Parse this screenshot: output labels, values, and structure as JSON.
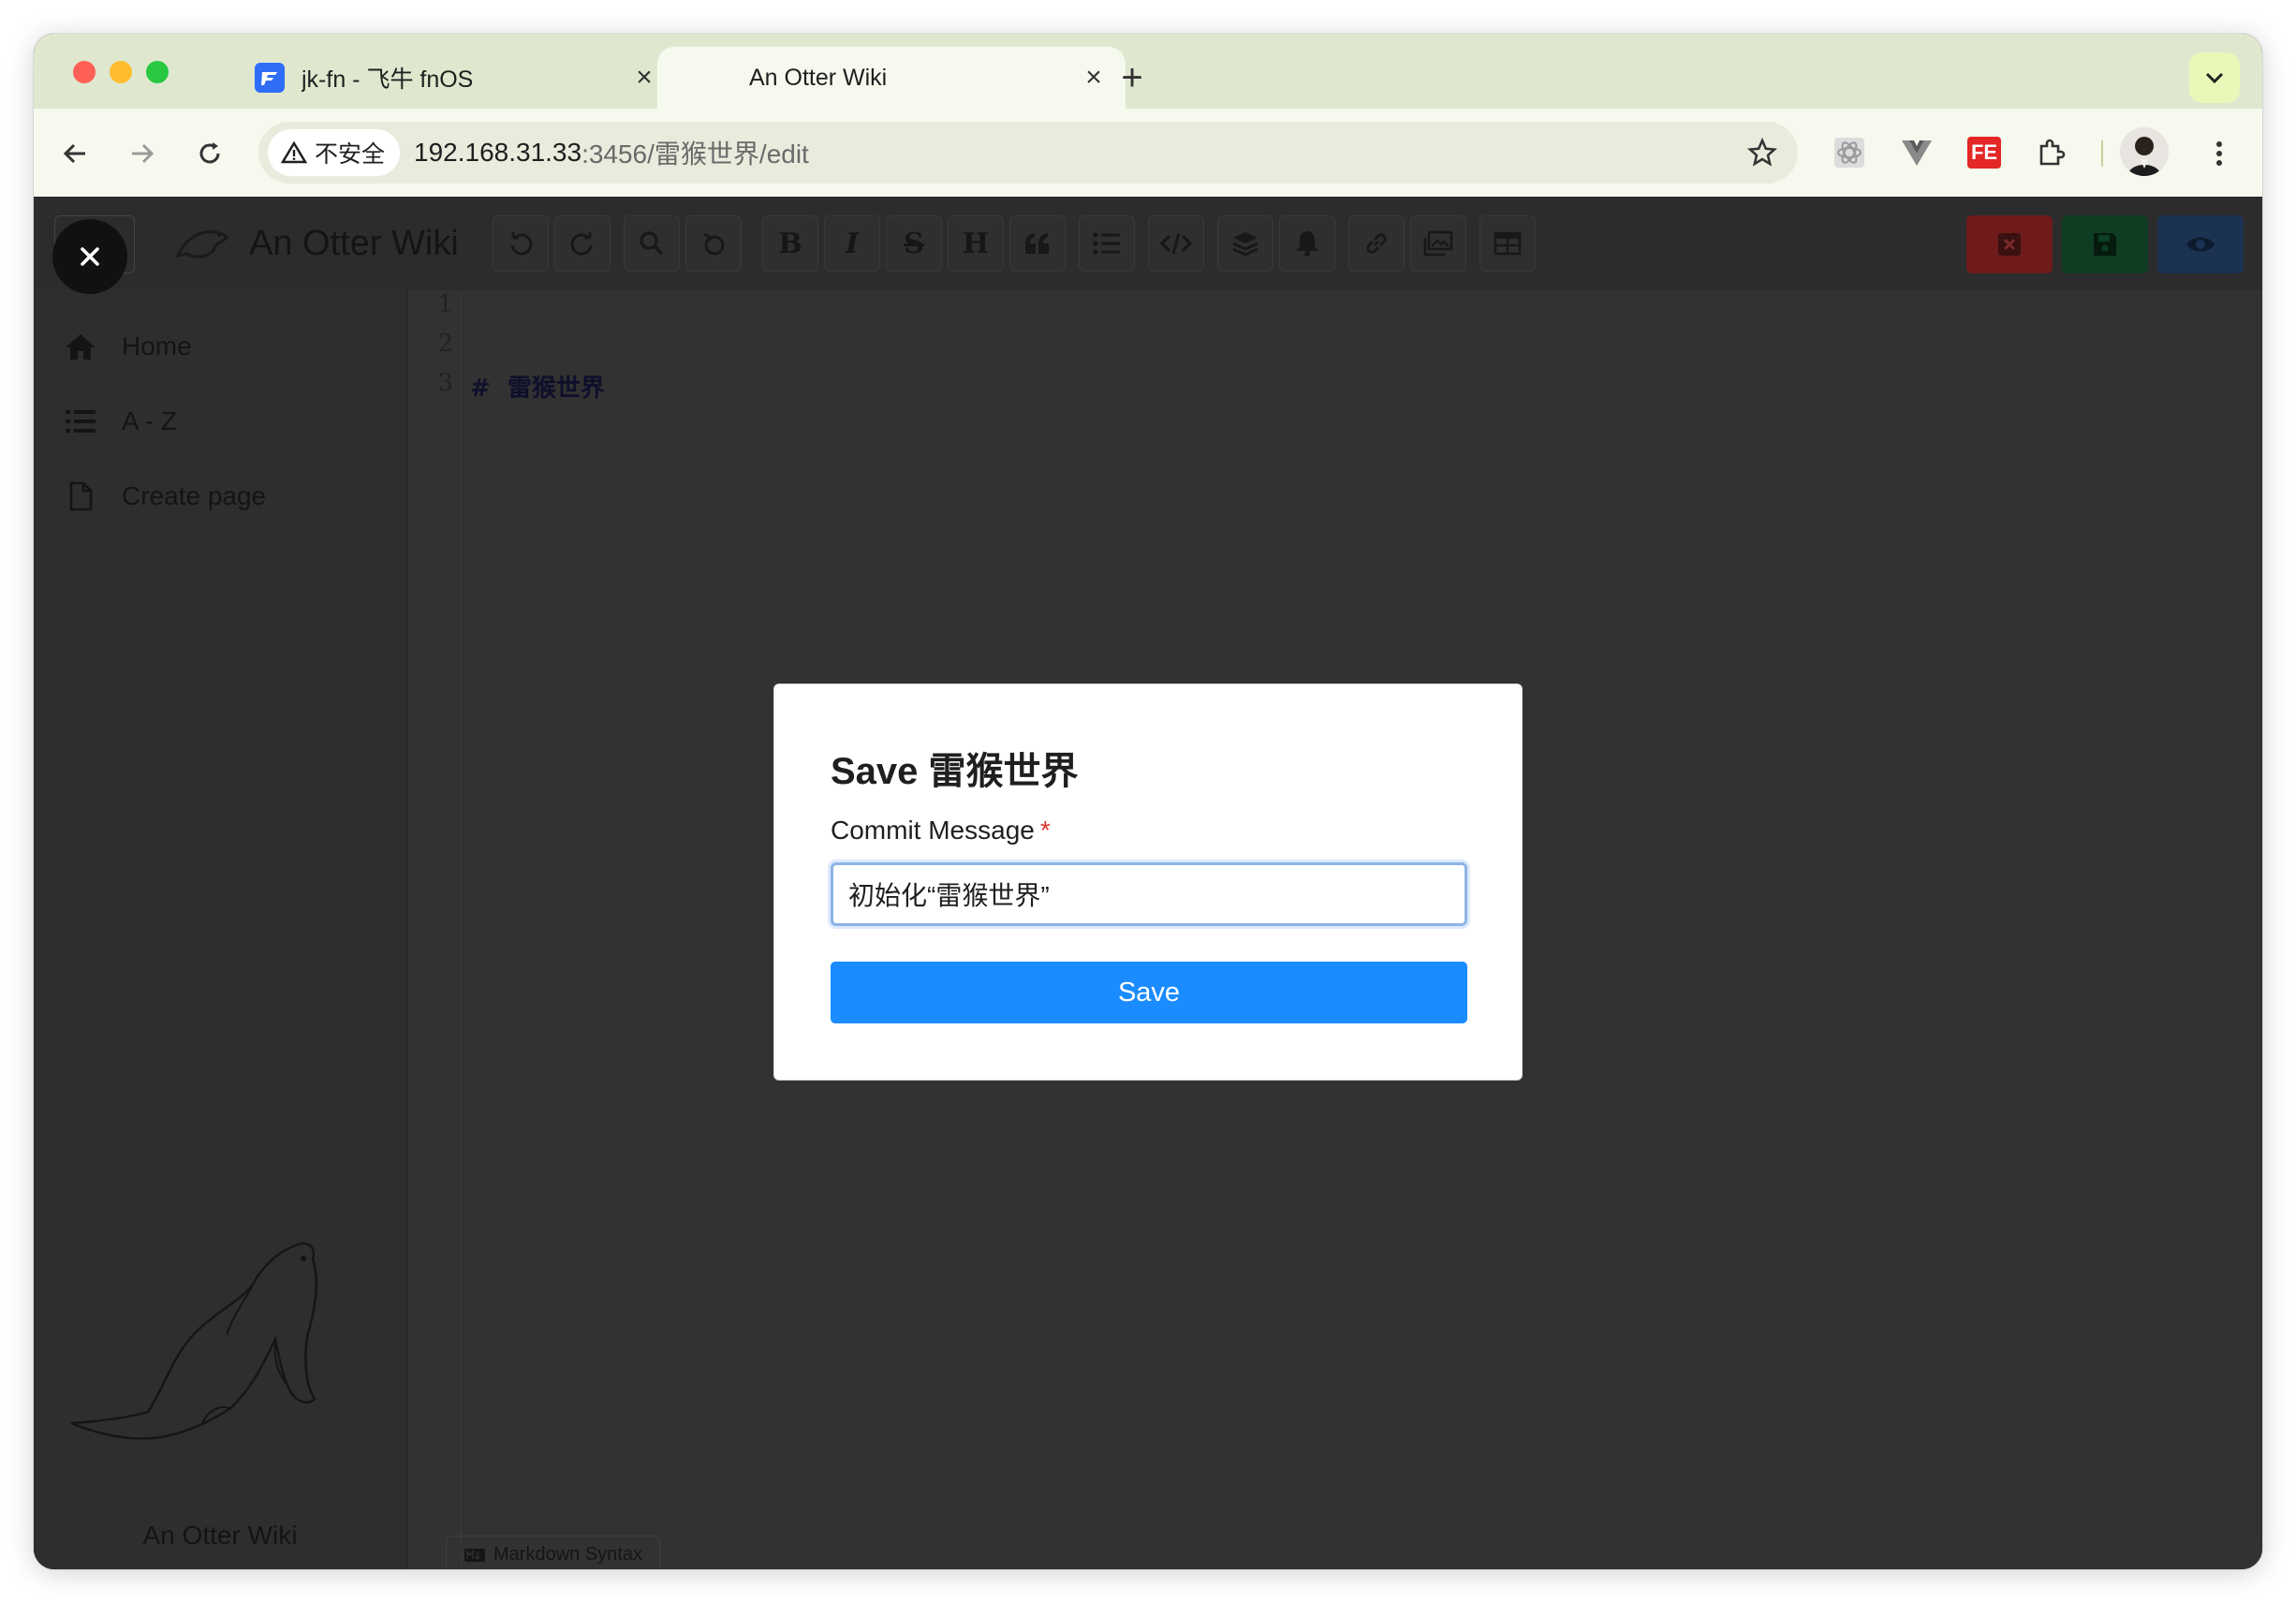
{
  "browser": {
    "tabs": [
      {
        "title": "jk-fn - 飞牛 fnOS",
        "active": false
      },
      {
        "title": "An Otter Wiki",
        "active": true
      }
    ],
    "security_label": "不安全",
    "url_host": "192.168.31.33",
    "url_rest": ":3456/雷猴世界/edit",
    "extension_fe_label": "FE"
  },
  "app": {
    "brand": "An Otter Wiki",
    "sidebar": {
      "items": [
        {
          "label": "Home",
          "icon": "home-icon"
        },
        {
          "label": "A - Z",
          "icon": "list-icon"
        },
        {
          "label": "Create page",
          "icon": "file-icon"
        }
      ],
      "footer": "An Otter Wiki"
    },
    "editor": {
      "line_numbers": [
        "1",
        "2",
        "3"
      ],
      "lines": [
        "#  雷猴世界",
        "",
        ""
      ],
      "syntax_badge": "Markdown Syntax"
    }
  },
  "dialog": {
    "title": "Save 雷猴世界",
    "label": "Commit Message",
    "required_mark": "*",
    "input_value": "初始化“雷猴世界”",
    "save_label": "Save"
  },
  "colors": {
    "accent": "#1a8cff",
    "tab_strip": "#dfe8cf",
    "required": "#e0312e"
  }
}
